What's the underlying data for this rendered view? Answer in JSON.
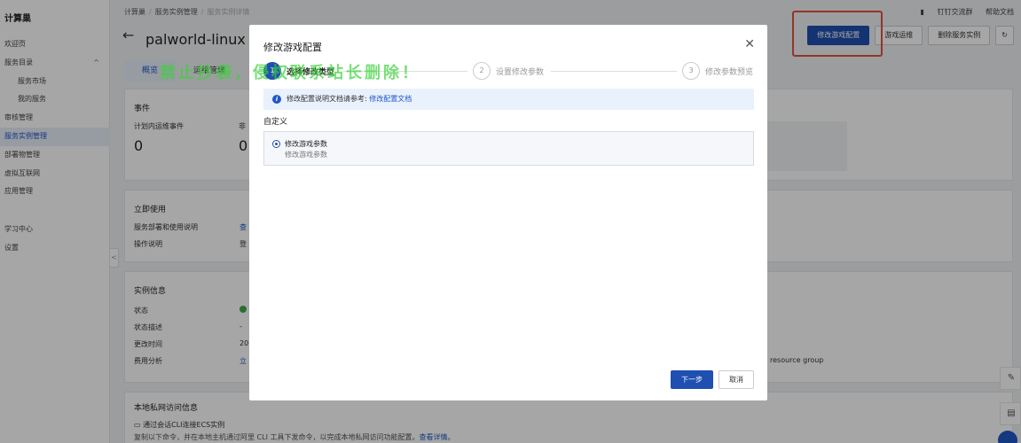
{
  "app": {
    "logo": "计算巢"
  },
  "sidebar": {
    "items": [
      {
        "label": "欢迎页"
      },
      {
        "label": "服务目录",
        "chevron": "^"
      },
      {
        "label": "服务市场",
        "sub": true
      },
      {
        "label": "我的服务",
        "sub": true
      },
      {
        "label": "审核管理"
      },
      {
        "label": "服务实例管理",
        "active": true
      },
      {
        "label": "部署物管理"
      },
      {
        "label": "虚拟互联网"
      },
      {
        "label": "应用管理"
      }
    ],
    "bottom_items": [
      {
        "label": "学习中心"
      },
      {
        "label": "设置"
      }
    ],
    "collapse_icon": "<"
  },
  "breadcrumb": {
    "items": [
      "计算巢",
      "服务实例管理",
      "服务实例详情"
    ],
    "sep": "/"
  },
  "toplinks": {
    "dingtalk": "钉钉交流群",
    "help": "帮助文档"
  },
  "header": {
    "back_icon": "←",
    "title": "palworld-linux（s",
    "actions": {
      "modify_config": "修改游戏配置",
      "game_ops": "游戏运维",
      "delete": "删除服务实例",
      "refresh_icon": "↻"
    }
  },
  "tabs": [
    {
      "label": "概览",
      "active": true
    },
    {
      "label": "运维管理"
    },
    {
      "label": "资"
    }
  ],
  "events": {
    "title": "事件",
    "planned_label": "计划内运维事件",
    "planned_value": "0",
    "unplanned_label": "非",
    "unplanned_value": "0"
  },
  "quickstart": {
    "title": "立即使用",
    "rows": [
      {
        "label": "服务部署和使用说明",
        "value": "查"
      },
      {
        "label": "操作说明",
        "value": "登"
      }
    ]
  },
  "instance_info": {
    "title": "实例信息",
    "rows": [
      {
        "label": "状态",
        "value": ""
      },
      {
        "label": "状态描述",
        "value": "-"
      },
      {
        "label": "更改时间",
        "value": "20"
      },
      {
        "label": "费用分析",
        "value": "立"
      }
    ],
    "resource_group": "resource group"
  },
  "private_access": {
    "title": "本地私网访问信息",
    "item": "通过会话CLI连接ECS实例",
    "desc_prefix": "复制以下命令，并在本地主机通过阿里 CLI 工具下发命令，以完成本地私网访问功能配置。",
    "desc_link": "查看详情。"
  },
  "float_buttons": {
    "edit_icon": "✎",
    "chat_icon": "▤",
    "help_bubble": ""
  },
  "modal": {
    "title": "修改游戏配置",
    "close_icon": "✕",
    "steps": [
      {
        "num": "1",
        "label": "选择修改类型",
        "active": true
      },
      {
        "num": "2",
        "label": "设置修改参数"
      },
      {
        "num": "3",
        "label": "修改参数预览"
      }
    ],
    "watermark": "禁止抄袭，侵权联系站长删除！",
    "info": {
      "icon": "i",
      "text": "修改配置说明文档请参考: ",
      "link": "修改配置文档"
    },
    "section_label": "自定义",
    "option": {
      "title": "修改游戏参数",
      "desc": "修改游戏参数"
    },
    "footer": {
      "next": "下一步",
      "cancel": "取消"
    }
  },
  "colors": {
    "primary": "#1f4fb0",
    "highlight_border": "#e0533e",
    "watermark": "#3cd23c"
  }
}
